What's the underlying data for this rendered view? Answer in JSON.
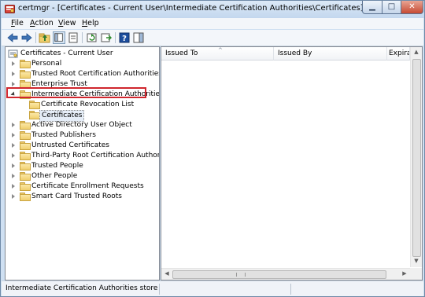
{
  "window": {
    "title": "certmgr - [Certificates - Current User\\Intermediate Certification Authorities\\Certificates]"
  },
  "menu": [
    {
      "label": "File",
      "u": "F",
      "rest": "ile"
    },
    {
      "label": "Action",
      "u": "A",
      "rest": "ction"
    },
    {
      "label": "View",
      "u": "V",
      "rest": "iew"
    },
    {
      "label": "Help",
      "u": "H",
      "rest": "elp"
    }
  ],
  "toolbar": {
    "icons": [
      "back-arrow-icon",
      "forward-arrow-icon",
      "up-folder-icon",
      "show-tree-icon",
      "properties-icon",
      "refresh-icon",
      "export-list-icon",
      "help-icon",
      "show-hide-action-pane-icon"
    ]
  },
  "tree": {
    "root": "Certificates - Current User",
    "items": [
      {
        "label": "Personal"
      },
      {
        "label": "Trusted Root Certification Authorities"
      },
      {
        "label": "Enterprise Trust"
      },
      {
        "label": "Intermediate Certification Authorities"
      },
      {
        "label": "Certificate Revocation List"
      },
      {
        "label": "Certificates"
      },
      {
        "label": "Active Directory User Object"
      },
      {
        "label": "Trusted Publishers"
      },
      {
        "label": "Untrusted Certificates"
      },
      {
        "label": "Third-Party Root Certification Authorities"
      },
      {
        "label": "Trusted People"
      },
      {
        "label": "Other People"
      },
      {
        "label": "Certificate Enrollment Requests"
      },
      {
        "label": "Smart Card Trusted Roots"
      }
    ]
  },
  "list": {
    "columns": [
      "Issued To",
      "Issued By",
      "Expirati"
    ]
  },
  "status": {
    "text": "Intermediate Certification Authorities store"
  },
  "colors": {
    "highlight": "#d0262e",
    "accent": "#3f73b4"
  }
}
